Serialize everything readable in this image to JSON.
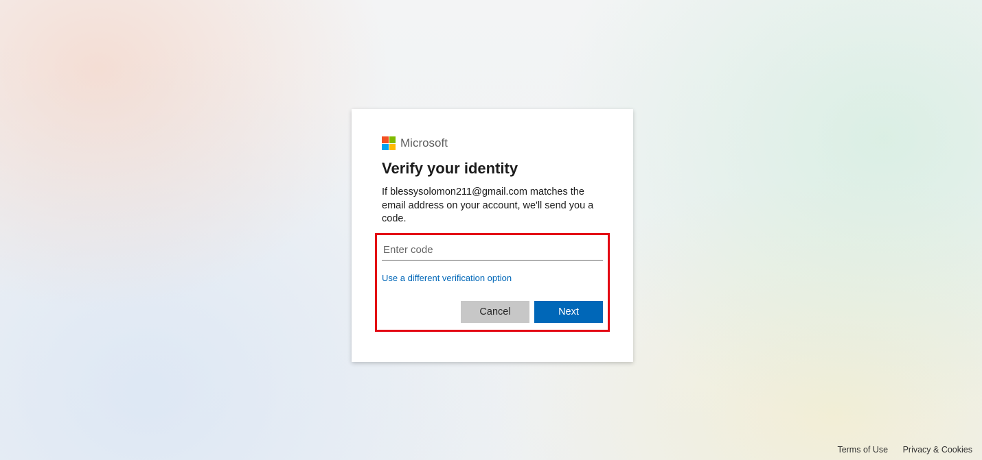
{
  "brand": {
    "name": "Microsoft"
  },
  "card": {
    "title": "Verify your identity",
    "description": "If blessysolomon211@gmail.com matches the email address on your account, we'll send you a code.",
    "code_placeholder": "Enter code",
    "code_value": "",
    "alt_option": "Use a different verification option",
    "cancel_label": "Cancel",
    "next_label": "Next"
  },
  "footer": {
    "terms": "Terms of Use",
    "privacy": "Privacy & Cookies"
  }
}
